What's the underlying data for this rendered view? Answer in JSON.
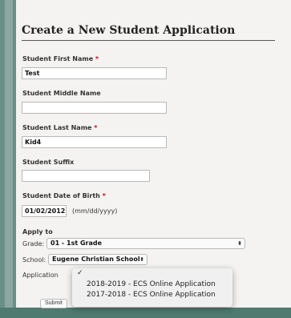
{
  "form": {
    "title": "Create a New Student Application",
    "required_marker": "*",
    "first_name": {
      "label": "Student First Name",
      "value": "Test"
    },
    "middle_name": {
      "label": "Student Middle Name",
      "value": ""
    },
    "last_name": {
      "label": "Student Last Name",
      "value": "Kid4"
    },
    "suffix": {
      "label": "Student Suffix",
      "value": ""
    },
    "dob": {
      "label": "Student Date of Birth",
      "value": "01/02/2012",
      "hint": "(mm/dd/yyyy)"
    },
    "apply_to": {
      "label": "Apply to"
    },
    "grade": {
      "label": "Grade:",
      "value": "01 - 1st Grade"
    },
    "school": {
      "label": "School:",
      "value": "Eugene Christian School"
    },
    "application": {
      "label": "Application"
    },
    "submit_label": "Submit"
  },
  "dropdown": {
    "checkmark": "✓",
    "options": [
      "2018-2019 - ECS Online Application",
      "2017-2018 - ECS Online Application"
    ]
  },
  "colors": {
    "background": "#4f7a6f",
    "panel": "#f4f3f1",
    "required": "#d0021b"
  },
  "icons": {
    "select_arrows": "select-arrows-icon",
    "check": "check-icon"
  }
}
